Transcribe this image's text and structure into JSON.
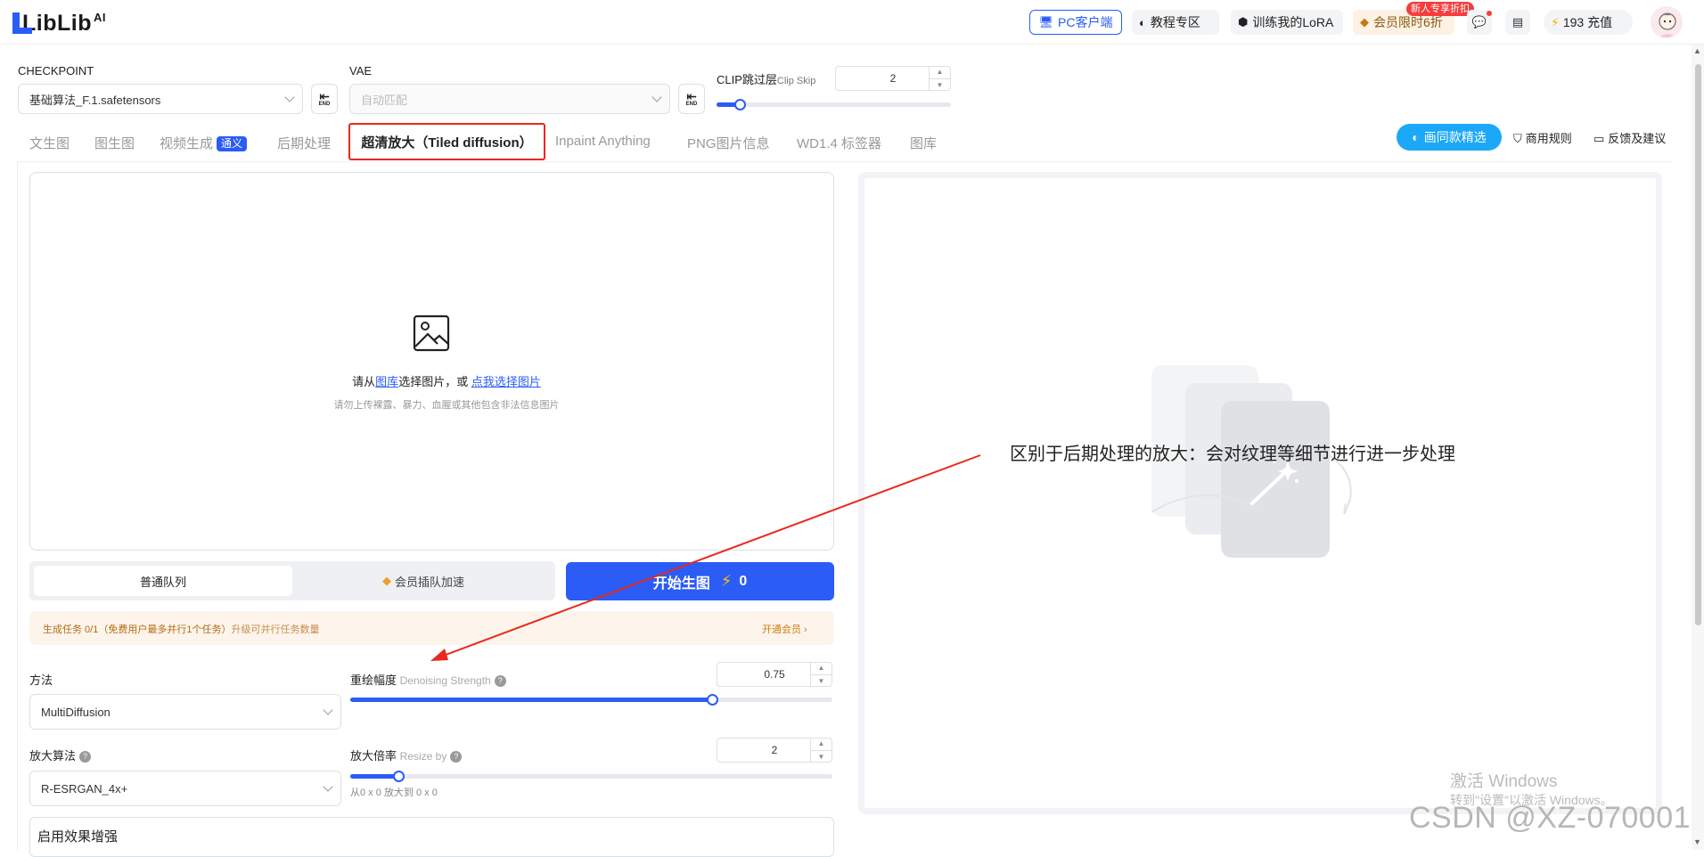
{
  "header": {
    "logo_text": "LibLib",
    "logo_sup": "AI",
    "pc_client": "PC客户端",
    "tutorial": "教程专区",
    "train_lora": "训练我的LoRA",
    "vip_label": "会员限时6折",
    "vip_badge": "新人专享折扣",
    "credits": "193 充值",
    "icons": {
      "pc": "monitor-icon",
      "tutorial": "palette-icon",
      "lora": "cube-icon",
      "vip": "diamond-icon",
      "msg": "chat-icon",
      "doc": "document-icon",
      "bolt": "bolt-icon"
    }
  },
  "models": {
    "checkpoint_label": "CHECKPOINT",
    "checkpoint_value": "基础算法_F.1.safetensors",
    "vae_label": "VAE",
    "vae_placeholder": "自动匹配",
    "end_label": "END",
    "clip_label": "CLIP跳过层",
    "clip_label_en": "Clip Skip",
    "clip_value": "2",
    "clip_slider_fraction": 0.1
  },
  "tabs": {
    "items": [
      "文生图",
      "图生图",
      "视频生成",
      "后期处理",
      "超清放大（Tiled diffusion）",
      "Inpaint Anything",
      "PNG图片信息",
      "WD1.4 标签器",
      "图库"
    ],
    "video_badge": "通义",
    "active_index": 4,
    "picks": "画同款精选",
    "rules": "商用规则",
    "feedback": "反馈及建议"
  },
  "upload": {
    "prefix": "请从",
    "gallery_link": "图库",
    "middle": "选择图片，或",
    "pick_link": "点我选择图片",
    "warning": "请勿上传裸露、暴力、血腥或其他包含非法信息图片"
  },
  "queue": {
    "normal": "普通队列",
    "vip": "会员插队加速"
  },
  "generate": {
    "label": "开始生图",
    "cost": "0"
  },
  "task": {
    "text": "生成任务 0/1（免费用户最多并行1个任务）",
    "upgrade": "升级可并行任务数量",
    "open_vip": "开通会员 ›"
  },
  "params": {
    "method_label": "方法",
    "method_value": "MultiDiffusion",
    "denoise_label": "重绘幅度",
    "denoise_label_en": "Denoising Strength",
    "denoise_value": "0.75",
    "denoise_fraction": 0.75,
    "upscaler_label": "放大算法",
    "upscaler_value": "R-ESRGAN_4x+",
    "resize_label": "放大倍率",
    "resize_label_en": "Resize by",
    "resize_value": "2",
    "resize_fraction": 0.1,
    "resize_hint": "从0 x 0 放大到 0 x 0",
    "enhance_label": "启用效果增强"
  },
  "result": {
    "annotation": "区别于后期处理的放大：会对纹理等细节进行进一步处理"
  },
  "watermarks": {
    "win_line1": "激活 Windows",
    "win_line2": "转到\"设置\"以激活 Windows。",
    "csdn": "CSDN @XZ-070001"
  },
  "colors": {
    "accent": "#2b5cf6",
    "highlight_box": "#e8291b",
    "arrow": "#e8291b",
    "picks": "#1ba8f7"
  }
}
